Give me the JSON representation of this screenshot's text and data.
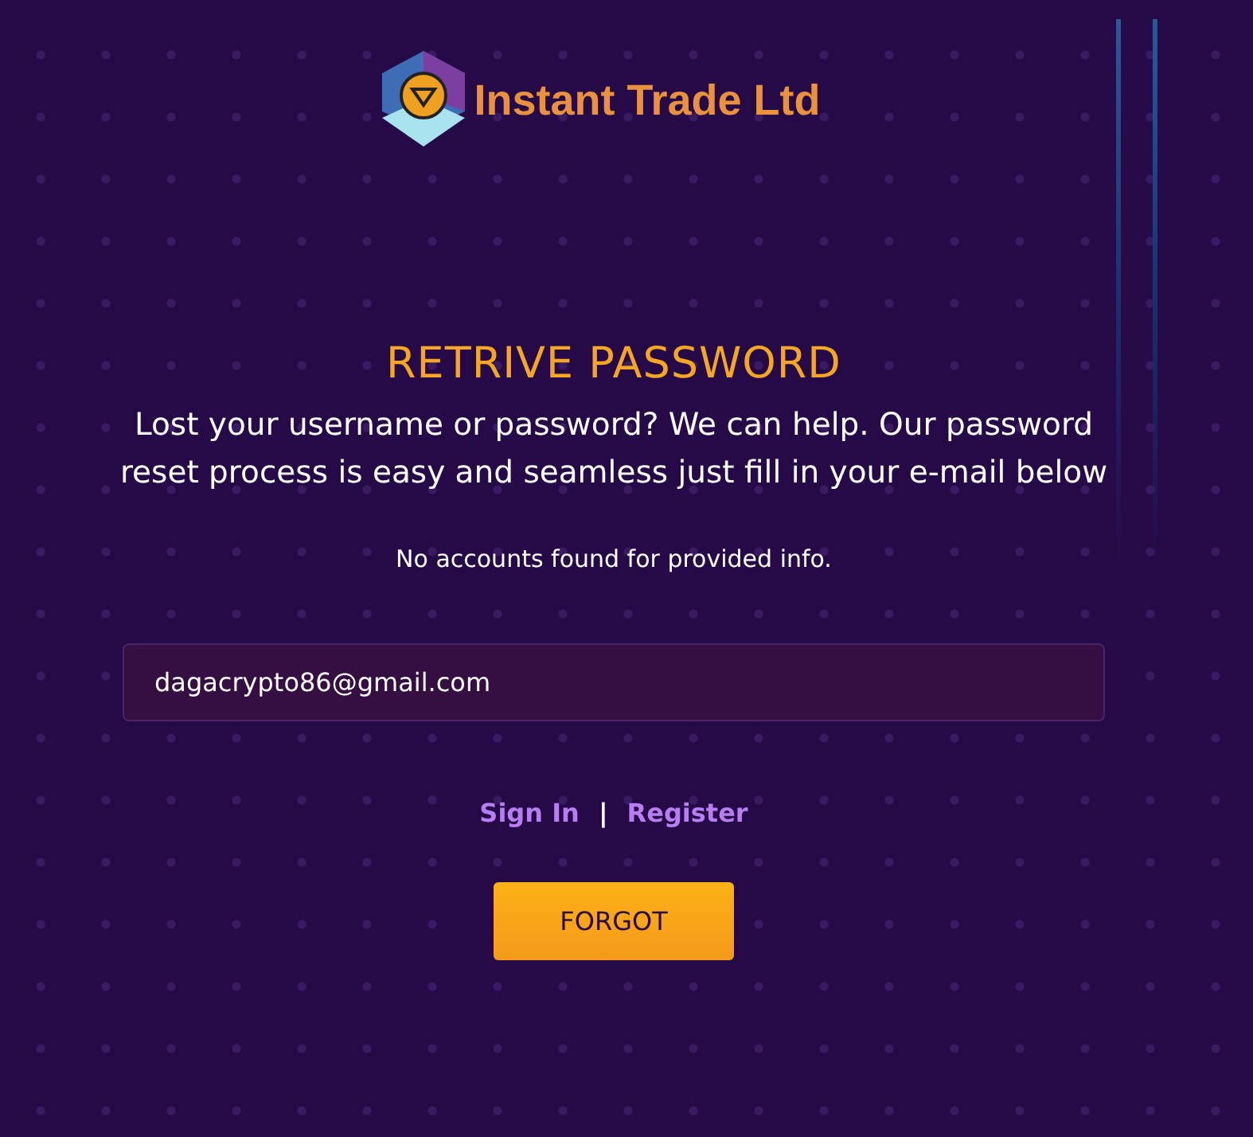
{
  "brand": {
    "name": "Instant Trade Ltd"
  },
  "title": "RETRIVE PASSWORD",
  "intro": "Lost your username or password? We can help. Our password reset process is easy and seamless just fill in your e-mail below",
  "message": "No accounts found for provided info.",
  "email_field": {
    "value": "dagacrypto86@gmail.com"
  },
  "links": [
    {
      "label": "Sign In"
    },
    {
      "label": "Register"
    }
  ],
  "separator": "|",
  "button": "FORGOT"
}
